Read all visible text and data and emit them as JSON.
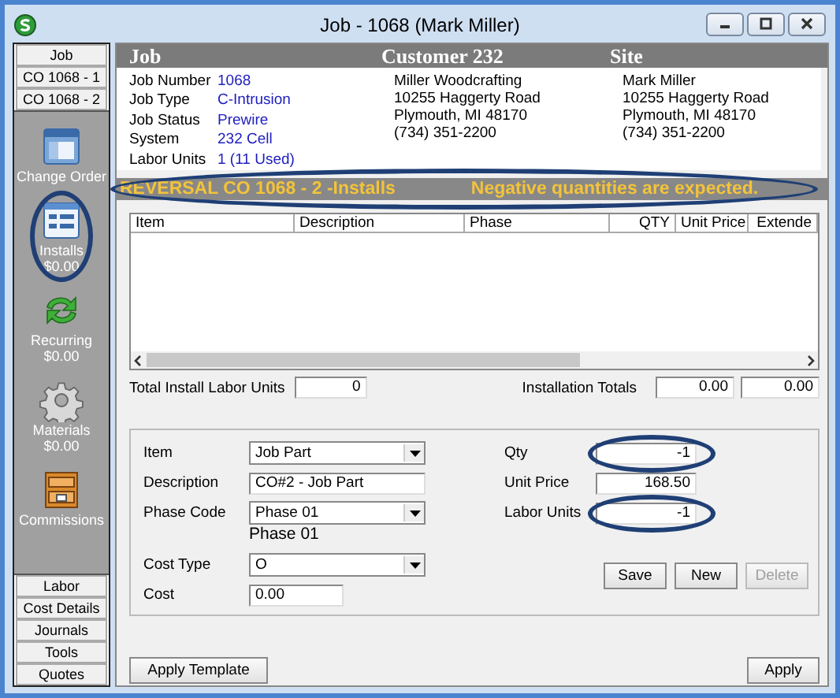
{
  "window": {
    "title": "Job - 1068 (Mark Miller)"
  },
  "sidebar": {
    "top_tabs": [
      {
        "label": "Job"
      },
      {
        "label": "CO 1068 - 1"
      },
      {
        "label": "CO 1068 - 2"
      }
    ],
    "items": [
      {
        "kind": "window",
        "label": "Change Order",
        "circled": false
      },
      {
        "kind": "list",
        "label": "Installs",
        "amount": "$0.00",
        "circled": true
      },
      {
        "kind": "arrows",
        "label": "Recurring",
        "amount": "$0.00",
        "circled": false
      },
      {
        "kind": "gear",
        "label": "Materials",
        "amount": "$0.00",
        "circled": false
      },
      {
        "kind": "drawer",
        "label": "Commissions",
        "circled": false
      }
    ],
    "bottom_tabs": [
      {
        "label": "Labor"
      },
      {
        "label": "Cost Details"
      },
      {
        "label": "Journals"
      },
      {
        "label": "Tools"
      },
      {
        "label": "Quotes"
      }
    ]
  },
  "header": [
    "Job",
    "Customer 232",
    "Site"
  ],
  "job_info": [
    {
      "label": "Job Number",
      "value": "1068"
    },
    {
      "label": "Job Type",
      "value": "C-Intrusion"
    },
    {
      "label": "Job Status",
      "value": "Prewire"
    },
    {
      "label": "System",
      "value": "232 Cell"
    },
    {
      "label": "Labor Units",
      "value": "1 (11 Used)"
    }
  ],
  "customer": [
    "Miller Woodcrafting",
    "10255 Haggerty Road",
    "Plymouth, MI  48170",
    "(734) 351-2200"
  ],
  "site": [
    "Mark Miller",
    "10255 Haggerty Road",
    "Plymouth, MI  48170",
    "(734) 351-2200"
  ],
  "banner": {
    "title": "REVERSAL  CO 1068 - 2 -Installs",
    "message": "Negative quantities are expected.",
    "circled": true
  },
  "table": {
    "columns": [
      {
        "label": "Item",
        "kind": "text"
      },
      {
        "label": "Description",
        "kind": "text"
      },
      {
        "label": "Phase",
        "kind": "text"
      },
      {
        "label": "QTY",
        "kind": "number"
      },
      {
        "label": "Unit Price",
        "kind": "number"
      },
      {
        "label": "Extende",
        "kind": "number"
      }
    ]
  },
  "totals": {
    "labor_label": "Total Install Labor Units",
    "labor_value": "0",
    "install_label": "Installation Totals",
    "install_values": [
      "0.00",
      "0.00"
    ]
  },
  "form": {
    "left": [
      {
        "kind": "dropdown",
        "label": "Item",
        "value": "Job Part"
      },
      {
        "kind": "text",
        "label": "Description",
        "value": "CO#2 - Job Part"
      },
      {
        "kind": "dropdown",
        "label": "Phase Code",
        "value": "Phase 01",
        "note": "Phase 01"
      },
      {
        "kind": "dropdown",
        "label": "Cost Type",
        "value": "O"
      },
      {
        "kind": "short",
        "label": "Cost",
        "value": "0.00"
      }
    ],
    "right": [
      {
        "label": "Qty",
        "value": "-1",
        "circled": true
      },
      {
        "label": "Unit Price",
        "value": "168.50",
        "circled": false
      },
      {
        "label": "Labor Units",
        "value": "-1",
        "circled": true
      }
    ],
    "buttons": [
      {
        "label": "Save",
        "disabled": false
      },
      {
        "label": "New",
        "disabled": false
      },
      {
        "label": "Delete",
        "disabled": true
      }
    ]
  },
  "footer_buttons": [
    "Apply Template",
    "Apply"
  ]
}
